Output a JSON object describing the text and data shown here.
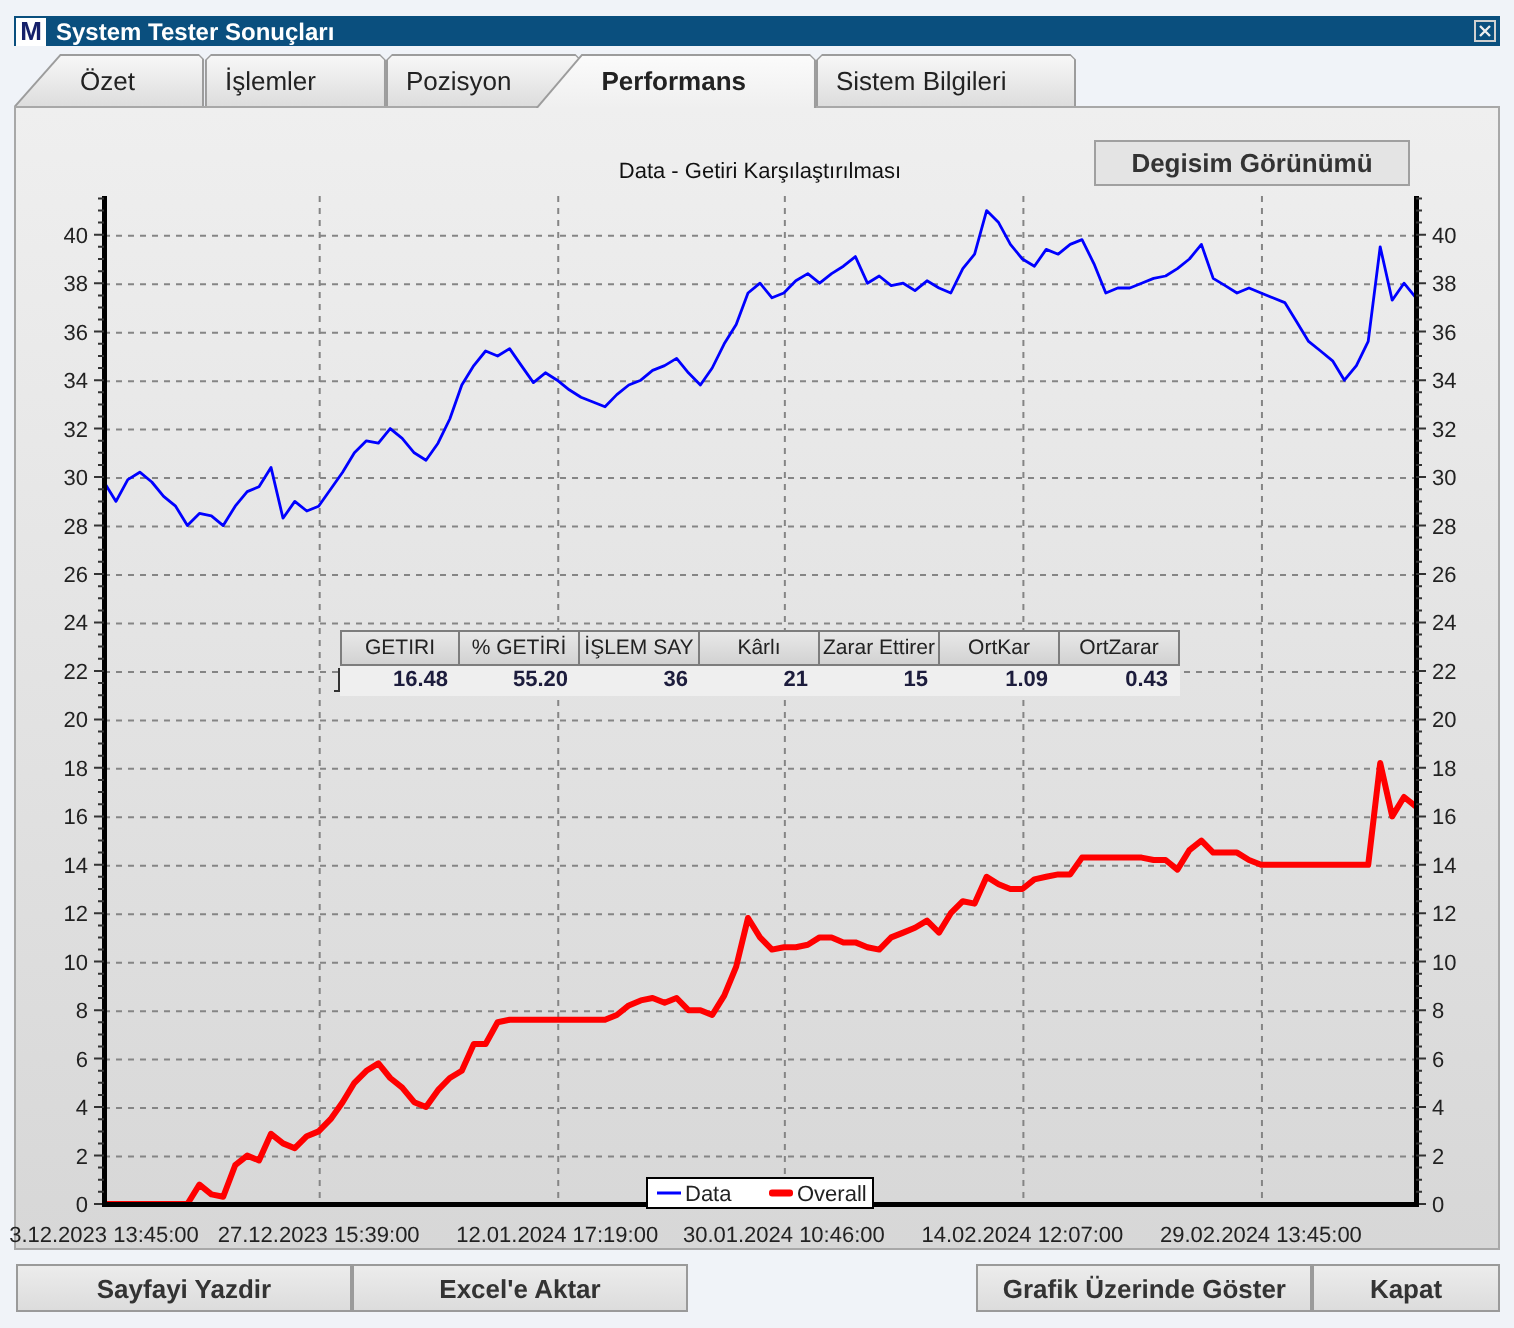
{
  "window": {
    "logo": "M",
    "title": "System Tester Sonuçları"
  },
  "tabs": [
    {
      "label": "Özet",
      "selected": false
    },
    {
      "label": "İşlemler",
      "selected": false
    },
    {
      "label": "Pozisyon",
      "selected": false
    },
    {
      "label": "Performans",
      "selected": true
    },
    {
      "label": "Sistem Bilgileri",
      "selected": false
    }
  ],
  "performance_panel": {
    "view_button": "Degisim Görünümü",
    "left_axis_labels": [
      "40",
      "38",
      "36",
      "34",
      "32",
      "30",
      "28",
      "26",
      "24",
      "22",
      "20",
      "18",
      "16",
      "14",
      "12",
      "10",
      "8",
      "6",
      "4",
      "2",
      "0"
    ],
    "chart_data": {
      "type": "line",
      "title": "Data - Getiri Karşılaştırılması",
      "categories": [
        "3.12.2023 13:45:00",
        null,
        null,
        null,
        null,
        null,
        null,
        null,
        null,
        null,
        null,
        null,
        null,
        null,
        null,
        null,
        null,
        null,
        "27.12.2023 15:39:00",
        null,
        null,
        null,
        null,
        null,
        null,
        null,
        null,
        null,
        null,
        null,
        null,
        null,
        null,
        null,
        null,
        null,
        null,
        null,
        "12.01.2024 17:19:00",
        null,
        null,
        null,
        null,
        null,
        null,
        null,
        null,
        null,
        null,
        null,
        null,
        null,
        null,
        null,
        null,
        null,
        null,
        "30.01.2024 10:46:00",
        null,
        null,
        null,
        null,
        null,
        null,
        null,
        null,
        null,
        null,
        null,
        null,
        null,
        null,
        null,
        null,
        null,
        null,
        null,
        "14.02.2024 12:07:00",
        null,
        null,
        null,
        null,
        null,
        null,
        null,
        null,
        null,
        null,
        null,
        null,
        null,
        null,
        null,
        null,
        null,
        null,
        null,
        "29.02.2024 13:45:00",
        null,
        null,
        null,
        null,
        null,
        null,
        null,
        null,
        null,
        null,
        null,
        null,
        null
      ],
      "ylim": [
        0,
        41.6
      ],
      "yticks": [
        0,
        2,
        4,
        6,
        8,
        10,
        12,
        14,
        16,
        18,
        20,
        22,
        24,
        26,
        28,
        30,
        32,
        34,
        36,
        38,
        40
      ],
      "grid": true,
      "legend": "bottom",
      "series": [
        {
          "name": "Data",
          "color": "#0000ff",
          "values": [
            29.8,
            29.0,
            29.9,
            30.2,
            29.8,
            29.2,
            28.8,
            28.0,
            28.5,
            28.4,
            28.0,
            28.8,
            29.4,
            29.6,
            30.4,
            28.3,
            29.0,
            28.6,
            28.8,
            29.5,
            30.2,
            31.0,
            31.5,
            31.4,
            32.0,
            31.6,
            31.0,
            30.7,
            31.4,
            32.4,
            33.8,
            34.6,
            35.2,
            35.0,
            35.3,
            34.6,
            33.9,
            34.3,
            34.0,
            33.6,
            33.3,
            33.1,
            32.9,
            33.4,
            33.8,
            34.0,
            34.4,
            34.6,
            34.9,
            34.3,
            33.8,
            34.5,
            35.5,
            36.3,
            37.6,
            38.0,
            37.4,
            37.6,
            38.1,
            38.4,
            38.0,
            38.4,
            38.7,
            39.1,
            38.0,
            38.3,
            37.9,
            38.0,
            37.7,
            38.1,
            37.8,
            37.6,
            38.6,
            39.2,
            41.0,
            40.5,
            39.6,
            39.0,
            38.7,
            39.4,
            39.2,
            39.6,
            39.8,
            38.8,
            37.6,
            37.8,
            37.8,
            38.0,
            38.2,
            38.3,
            38.6,
            39.0,
            39.6,
            38.2,
            37.9,
            37.6,
            37.8,
            37.6,
            37.4,
            37.2,
            36.4,
            35.6,
            35.2,
            34.8,
            34.0,
            34.6,
            35.6,
            39.5,
            37.3,
            38.0,
            37.4
          ]
        },
        {
          "name": "Overall",
          "color": "#ff0000",
          "values": [
            0,
            0,
            0,
            0,
            0,
            0,
            0,
            0,
            0.8,
            0.4,
            0.3,
            1.6,
            2.0,
            1.8,
            2.9,
            2.5,
            2.3,
            2.8,
            3.0,
            3.5,
            4.2,
            5.0,
            5.5,
            5.8,
            5.2,
            4.8,
            4.2,
            4.0,
            4.7,
            5.2,
            5.5,
            6.6,
            6.6,
            7.5,
            7.6,
            7.6,
            7.6,
            7.6,
            7.6,
            7.6,
            7.6,
            7.6,
            7.6,
            7.8,
            8.2,
            8.4,
            8.5,
            8.3,
            8.5,
            8.0,
            8.0,
            7.8,
            8.6,
            9.8,
            11.8,
            11.0,
            10.5,
            10.6,
            10.6,
            10.7,
            11.0,
            11.0,
            10.8,
            10.8,
            10.6,
            10.5,
            11.0,
            11.2,
            11.4,
            11.7,
            11.2,
            12.0,
            12.5,
            12.4,
            13.5,
            13.2,
            13.0,
            13.0,
            13.4,
            13.5,
            13.6,
            13.6,
            14.3,
            14.3,
            14.3,
            14.3,
            14.3,
            14.3,
            14.2,
            14.2,
            13.8,
            14.6,
            15.0,
            14.5,
            14.5,
            14.5,
            14.2,
            14.0,
            14.0,
            14.0,
            14.0,
            14.0,
            14.0,
            14.0,
            14.0,
            14.0,
            14.0,
            18.2,
            16.0,
            16.8,
            16.4
          ]
        }
      ]
    },
    "summary_table": {
      "columns": [
        "GETIRI",
        "% GETİRİ",
        "İŞLEM SAY",
        "Kârlı",
        "Zarar Ettirer",
        "OrtKar",
        "OrtZarar"
      ],
      "rows": [
        [
          "16.48",
          "55.20",
          "36",
          "21",
          "15",
          "1.09",
          "0.43"
        ]
      ]
    }
  },
  "footer": {
    "left_buttons": [
      "Sayfayi Yazdir",
      "Excel'e Aktar"
    ],
    "right_buttons": [
      "Grafik Üzerinde Göster",
      "Kapat"
    ]
  }
}
